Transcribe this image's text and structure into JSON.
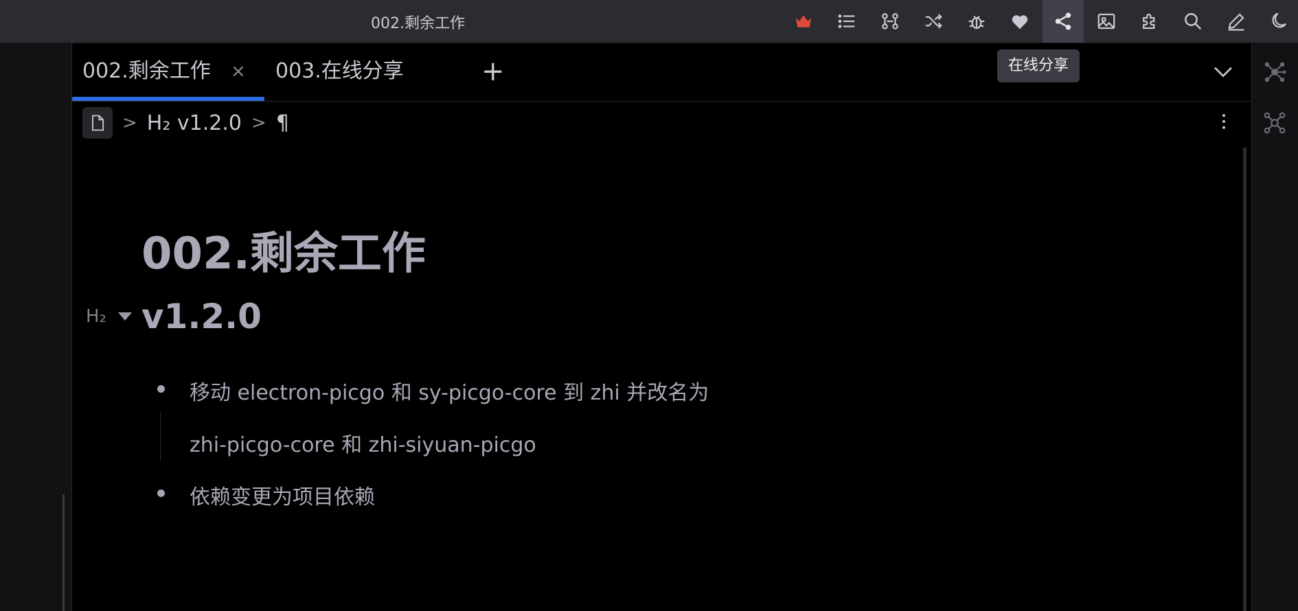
{
  "window": {
    "title": "002.剩余工作"
  },
  "toolbar": {
    "icons": [
      "crown-icon",
      "outline-icon",
      "graph-icon",
      "shuffle-icon",
      "bug-icon",
      "heart-icon",
      "share-icon",
      "image-icon",
      "plugin-icon",
      "search-icon",
      "edit-icon",
      "moon-icon"
    ],
    "active": "share-icon",
    "tooltip": "在线分享",
    "crown_color": "#e04a3a"
  },
  "tabs": [
    {
      "label": "002.剩余工作",
      "active": true,
      "close": "×"
    },
    {
      "label": "003.在线分享",
      "active": false
    }
  ],
  "tab_add": "+",
  "breadcrumb": {
    "heading": "H₂ v1.2.0",
    "paragraph": "¶"
  },
  "document": {
    "title": "002.剩余工作",
    "heading_marker": "H₂",
    "heading": "v1.2.0",
    "list": [
      {
        "line1": "移动 electron-picgo 和 sy-picgo-core 到 zhi 并改名为",
        "line2": "zhi-picgo-core 和 zhi-siyuan-picgo"
      },
      {
        "line1": "依赖变更为项目依赖"
      }
    ]
  },
  "accent_color": "#2f6be0"
}
